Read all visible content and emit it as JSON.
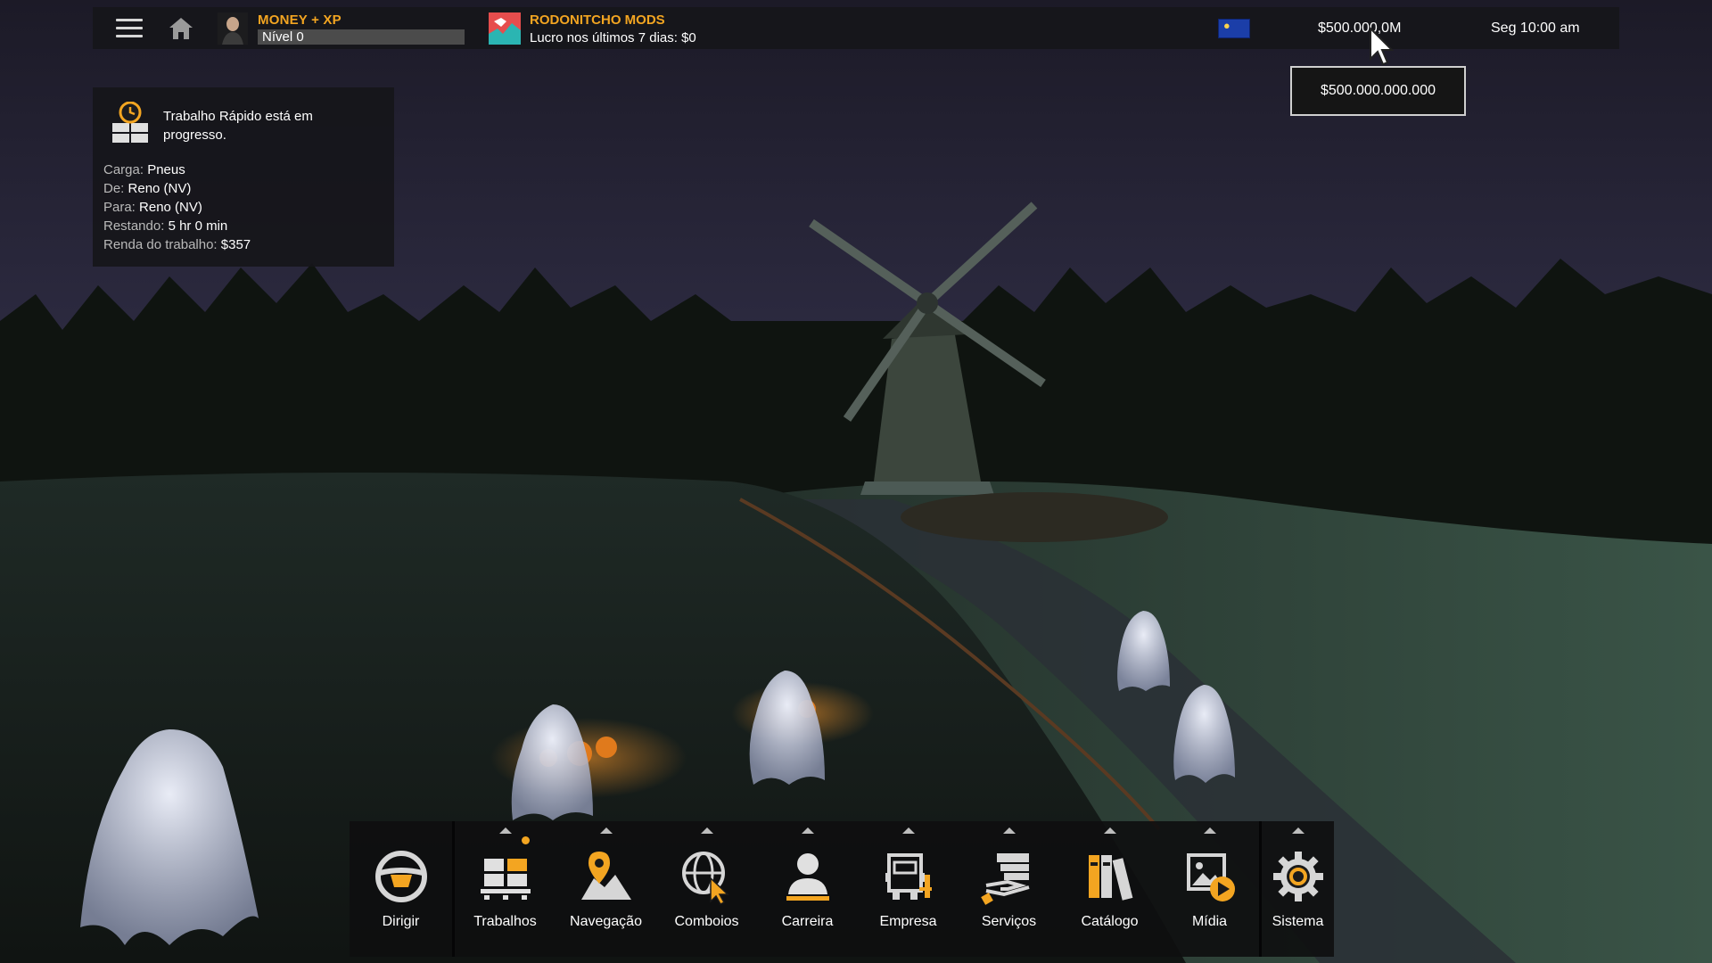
{
  "topbar": {
    "profile": {
      "name": "MONEY + XP",
      "level": "Nível 0"
    },
    "company": {
      "name": "RODONITCHO MODS",
      "profit": "Lucro nos últimos 7 dias: $0"
    },
    "money": "$500.000,0M",
    "datetime": "Seg 10:00 am",
    "money_tooltip": "$500.000.000.000"
  },
  "job": {
    "status": "Trabalho Rápido está em progresso.",
    "rows": [
      {
        "label": "Carga:",
        "value": "Pneus"
      },
      {
        "label": "De:",
        "value": "Reno (NV)"
      },
      {
        "label": "Para:",
        "value": "Reno (NV)"
      },
      {
        "label": "Restando:",
        "value": "5 hr 0 min"
      },
      {
        "label": "Renda do trabalho:",
        "value": "$357"
      }
    ]
  },
  "dock": {
    "items": [
      {
        "label": "Dirigir",
        "icon": "steering-wheel-icon"
      },
      {
        "label": "Trabalhos",
        "icon": "cargo-pallet-icon"
      },
      {
        "label": "Navegação",
        "icon": "map-pin-icon"
      },
      {
        "label": "Comboios",
        "icon": "globe-cursor-icon"
      },
      {
        "label": "Carreira",
        "icon": "person-icon"
      },
      {
        "label": "Empresa",
        "icon": "truck-garage-icon"
      },
      {
        "label": "Serviços",
        "icon": "hand-service-icon"
      },
      {
        "label": "Catálogo",
        "icon": "books-icon"
      },
      {
        "label": "Mídia",
        "icon": "media-play-icon"
      },
      {
        "label": "Sistema",
        "icon": "gear-icon"
      }
    ]
  },
  "colors": {
    "accent": "#f3a521",
    "panel": "#16161a",
    "flag": "#1b3ea8"
  }
}
